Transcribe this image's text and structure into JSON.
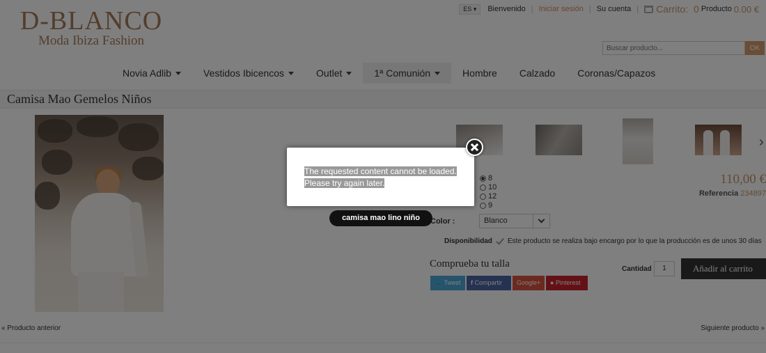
{
  "header": {
    "logo_line1": "D-BLANCO",
    "logo_line2": "Moda Ibiza Fashion",
    "lang": "ES",
    "welcome": "Bienvenido",
    "login": "Iniciar sesión",
    "account": "Su cuenta",
    "cart_label": "Carrito:",
    "cart_count": "0",
    "cart_product": "Producto",
    "cart_total": "0.00 €",
    "search_placeholder": "Buscar producto...",
    "search_button": "OK"
  },
  "nav": [
    {
      "label": "Novia Adlib",
      "dropdown": true
    },
    {
      "label": "Vestidos Ibicencos",
      "dropdown": true
    },
    {
      "label": "Outlet",
      "dropdown": true
    },
    {
      "label": "1ª Comunión",
      "dropdown": true,
      "active": true
    },
    {
      "label": "Hombre",
      "dropdown": false
    },
    {
      "label": "Calzado",
      "dropdown": false
    },
    {
      "label": "Coronas/Capazos",
      "dropdown": false
    }
  ],
  "product": {
    "title": "Camisa Mao Gemelos Niños",
    "sizes": [
      "8",
      "10",
      "12",
      "9"
    ],
    "selected_size": "8",
    "price": "110,00 €",
    "ref_label": "Referencia",
    "ref_value": "234897",
    "color_label": "Color :",
    "color_value": "Blanco",
    "availability_label": "Disponibilidad",
    "availability_text": "Este producto se realiza bajo encargo por lo que la producción es de unos 30 días",
    "size_check": "Comprueba tu talla",
    "qty_label": "Cantidad",
    "qty_value": "1",
    "add_to_cart": "Añadir al carrito"
  },
  "social": {
    "tweet": "Tweet",
    "share": "Compartir",
    "google": "Google+",
    "pinterest": "Pinterest"
  },
  "pager": {
    "prev": "« Producto anterior",
    "next": "Siguiente producto »"
  },
  "modal": {
    "line1": "The requested content cannot be loaded.",
    "line2": "Please try again later.",
    "caption": "camisa mao lino niño"
  }
}
